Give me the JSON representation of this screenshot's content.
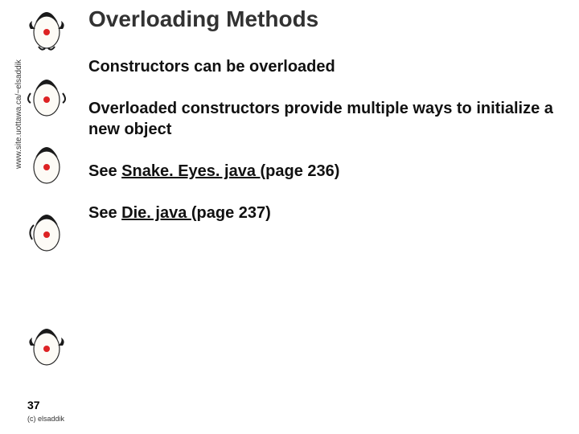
{
  "title": "Overloading Methods",
  "sidebar_url": "www.site.uottawa.ca/~elsaddik",
  "body": {
    "p1": "Constructors can be overloaded",
    "p2": "Overloaded constructors provide multiple ways to initialize a new object",
    "p3_prefix": "See ",
    "p3_link": "Snake. Eyes. java ",
    "p3_suffix": "(page 236)",
    "p4_prefix": "See ",
    "p4_link": "Die. java ",
    "p4_suffix": "(page 237)"
  },
  "page_number": "37",
  "copyright": "(c) elsaddik",
  "icons": {
    "duke": "java-duke-mascot-icon"
  }
}
